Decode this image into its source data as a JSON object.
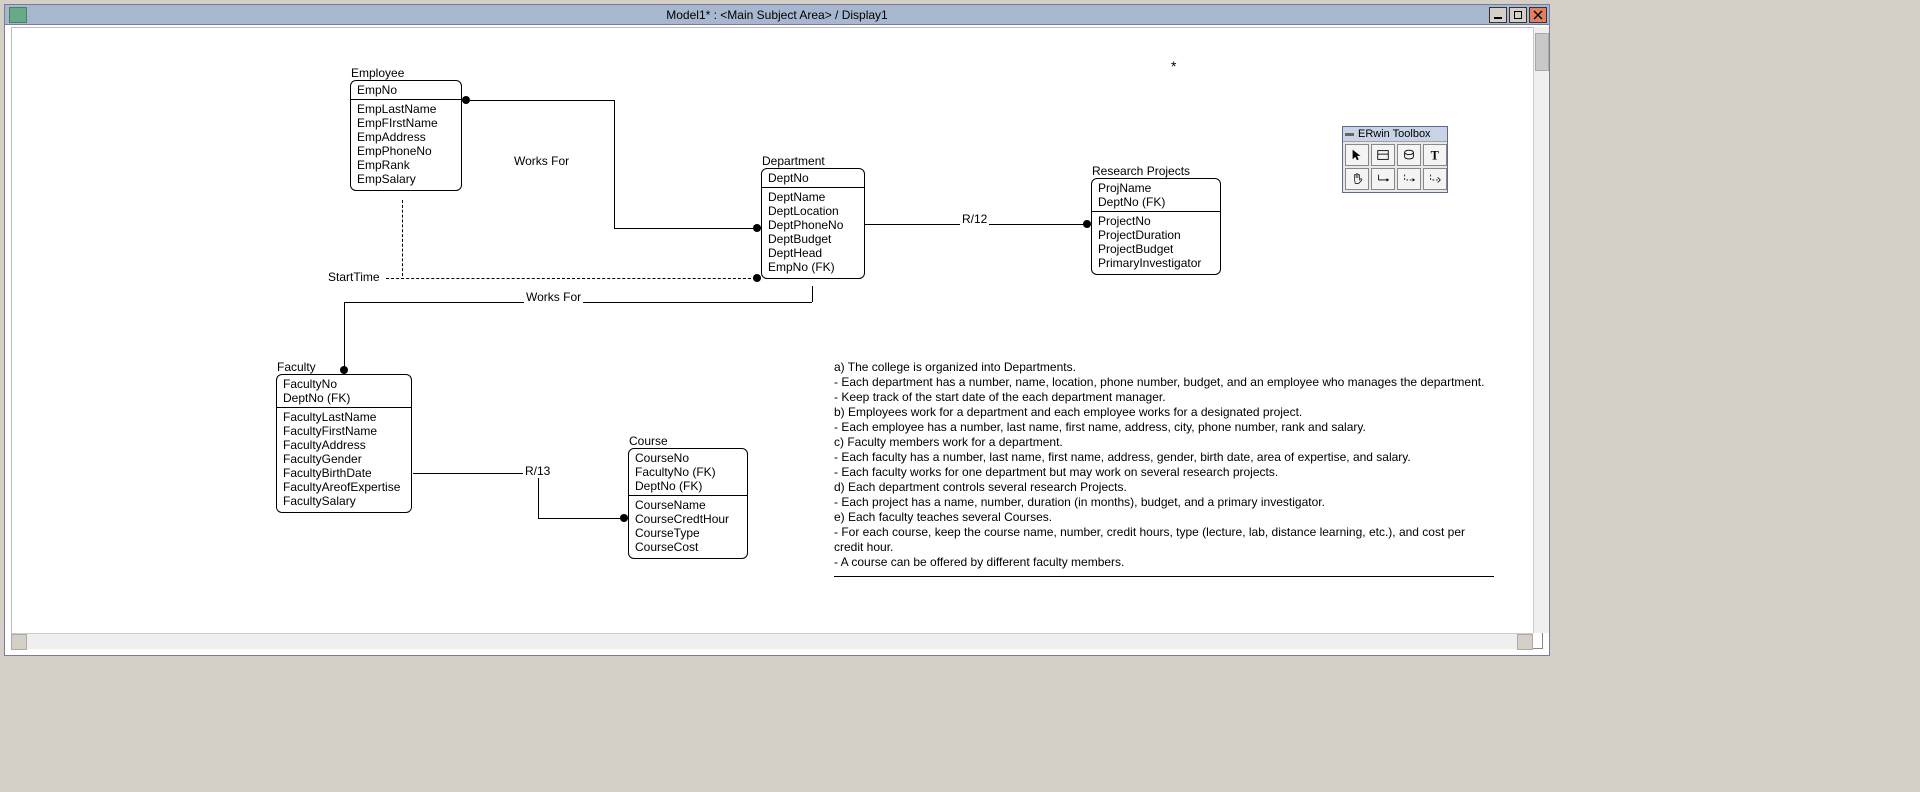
{
  "window": {
    "title": "Model1* : <Main Subject Area> / Display1"
  },
  "toolbox": {
    "title": "ERwin Toolbox",
    "tools": [
      "pointer",
      "entity",
      "view",
      "text",
      "hand",
      "rel-id",
      "rel-nonid",
      "rel-many"
    ]
  },
  "asterisk": "*",
  "entities": {
    "employee": {
      "title": "Employee",
      "pk": [
        "EmpNo"
      ],
      "attrs": [
        "EmpLastName",
        "EmpFIrstName",
        "EmpAddress",
        "EmpPhoneNo",
        "EmpRank",
        "EmpSalary"
      ]
    },
    "department": {
      "title": "Department",
      "pk": [
        "DeptNo"
      ],
      "attrs": [
        "DeptName",
        "DeptLocation",
        "DeptPhoneNo",
        "DeptBudget",
        "DeptHead",
        "EmpNo (FK)"
      ]
    },
    "research": {
      "title": "Research Projects",
      "pk": [
        "ProjName",
        "DeptNo (FK)"
      ],
      "attrs": [
        "ProjectNo",
        "ProjectDuration",
        "ProjectBudget",
        "PrimaryInvestigator"
      ]
    },
    "faculty": {
      "title": "Faculty",
      "pk": [
        "FacultyNo",
        "DeptNo (FK)"
      ],
      "attrs": [
        "FacultyLastName",
        "FacultyFirstName",
        "FacultyAddress",
        "FacultyGender",
        "FacultyBirthDate",
        "FacultyAreofExpertise",
        "FacultySalary"
      ]
    },
    "course": {
      "title": "Course",
      "pk": [
        "CourseNo",
        "FacultyNo (FK)",
        "DeptNo (FK)"
      ],
      "attrs": [
        "CourseName",
        "CourseCredtHour",
        "CourseType",
        "CourseCost"
      ]
    }
  },
  "rel_labels": {
    "emp_dept": "Works For",
    "dept_research": "R/12",
    "start_time": "StartTime",
    "dept_faculty": "Works For",
    "faculty_course": "R/13"
  },
  "requirements": {
    "lines": [
      "a) The college is organized into Departments.",
      "- Each department has a number, name, location, phone number, budget, and an employee who manages the department.",
      "- Keep track of the start date of the each department manager.",
      "b) Employees work for a department and each employee works for a designated project.",
      "- Each employee has a number, last name, first name, address, city, phone number, rank and salary.",
      "c) Faculty members work for a department.",
      "- Each faculty has a number, last name, first name, address, gender, birth date, area of expertise, and salary.",
      "- Each faculty works for one department but may work on several research projects.",
      "",
      "d) Each department controls several research Projects.",
      "- Each project has a name, number, duration (in months), budget, and a primary investigator.",
      "e) Each faculty teaches several Courses.",
      "- For each course, keep the course name, number, credit hours, type (lecture, lab, distance learning, etc.), and cost per credit hour.",
      "- A course can be offered by different faculty members."
    ]
  }
}
